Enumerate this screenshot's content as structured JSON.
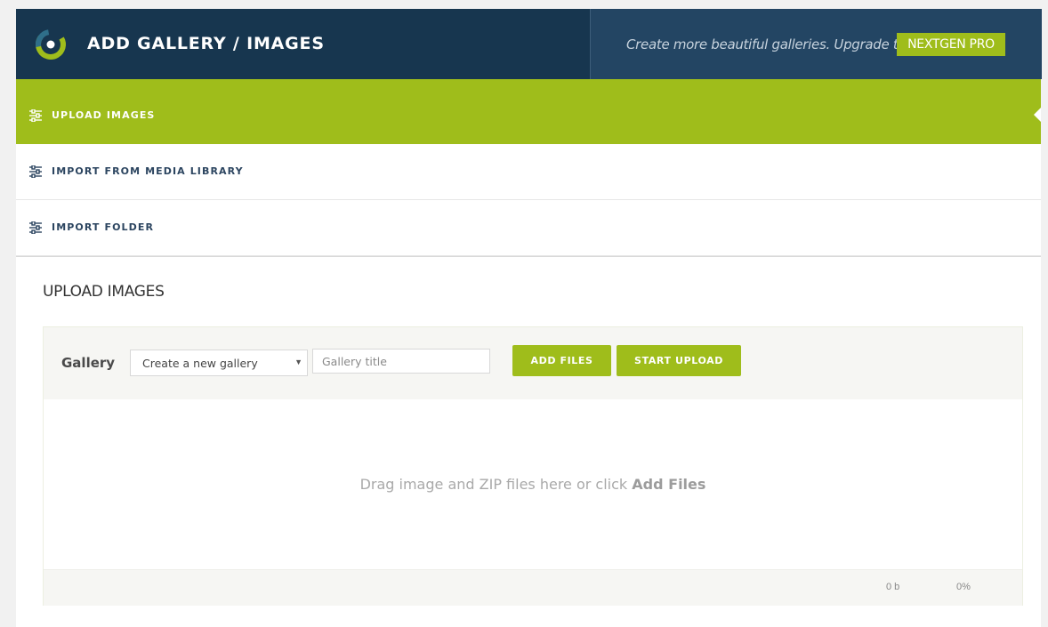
{
  "header": {
    "title": "ADD GALLERY / IMAGES",
    "promo_text": "Create more beautiful galleries. Upgrade to",
    "pro_button": "NEXTGEN PRO",
    "logo_icon": "nextgen-logo-icon"
  },
  "tabs": [
    {
      "label": "UPLOAD IMAGES",
      "active": true,
      "icon": "sliders-icon"
    },
    {
      "label": "IMPORT FROM MEDIA LIBRARY",
      "active": false,
      "icon": "sliders-icon"
    },
    {
      "label": "IMPORT FOLDER",
      "active": false,
      "icon": "sliders-icon"
    }
  ],
  "upload": {
    "section_title": "UPLOAD IMAGES",
    "gallery_label": "Gallery",
    "gallery_select_value": "Create a new gallery",
    "gallery_title_placeholder": "Gallery title",
    "add_files_button": "ADD FILES",
    "start_upload_button": "START UPLOAD",
    "drop_text": "Drag image and ZIP files here or click",
    "drop_link": "Add Files",
    "total_size": "0 b",
    "progress_percent": "0%"
  },
  "colors": {
    "header_bg": "#17364f",
    "promo_bg": "#234563",
    "accent": "#9fbd1b"
  }
}
